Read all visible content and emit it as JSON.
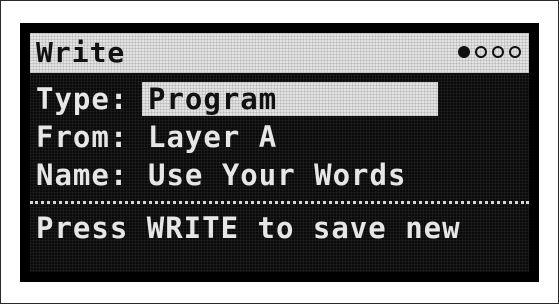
{
  "header": {
    "title": "Write",
    "page_indicator": {
      "total": 4,
      "current": 1
    }
  },
  "fields": [
    {
      "label": "Type:",
      "value": "Program"
    },
    {
      "label": "From:",
      "value": "Layer A"
    },
    {
      "label": "Name:",
      "value": "Use Your Words"
    }
  ],
  "message": "Press WRITE to save new",
  "colors": {
    "lcd_background": "#0a0a0a",
    "lcd_foreground": "#e6e6e6",
    "highlight_background": "#e3e3e3",
    "highlight_text": "#111111"
  }
}
